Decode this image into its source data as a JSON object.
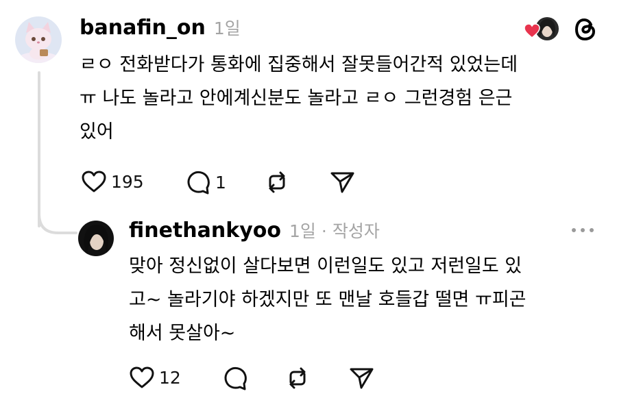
{
  "comment": {
    "username": "banafin_on",
    "time": "1일",
    "text": "ㄹㅇ 전화받다가 통화에 집중해서 잘못들어간적 있었는데\nㅠ 나도 놀라고 안에계신분도 놀라고 ㄹㅇ 그런경험 은근\n있어",
    "actions": {
      "likes": "195",
      "replies": "1"
    },
    "icons": [
      "heart-icon",
      "comment-icon",
      "repost-icon",
      "share-icon"
    ]
  },
  "header_icons": [
    "liked-by-heart-icon",
    "liker-avatar",
    "threads-logo-icon"
  ],
  "reply": {
    "username": "finethankyoo",
    "time": "1일",
    "separator": "·",
    "author_badge": "작성자",
    "text": "맞아 정신없이 살다보면 이런일도 있고 저런일도 있\n고~ 놀라기야 하겠지만 또 맨날 호들갑 떨면 ㅠ피곤\n해서 못살아~",
    "actions": {
      "likes": "12"
    },
    "icons": [
      "more-icon",
      "heart-icon",
      "comment-icon",
      "repost-icon",
      "share-icon"
    ]
  },
  "colors": {
    "heart_red": "#e8344e",
    "muted": "#a4a4a4",
    "line": "#dcdcdc"
  }
}
